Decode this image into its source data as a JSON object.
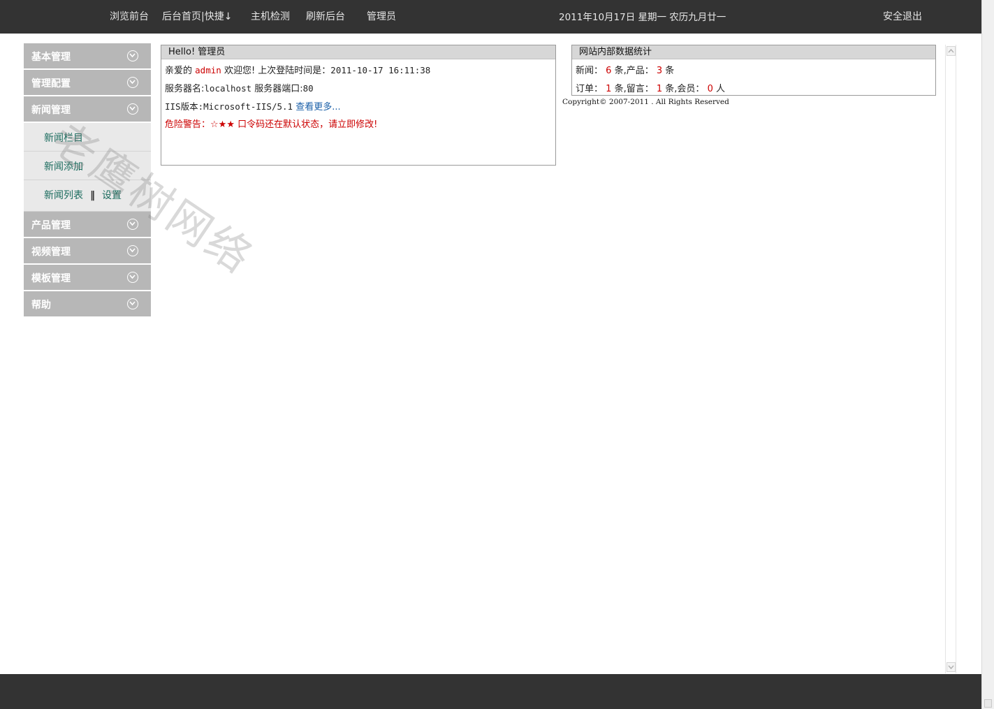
{
  "topbar": {
    "nav": [
      {
        "label": "浏览前台"
      },
      {
        "label": "后台首页|快捷↓"
      },
      {
        "label": "主机检测"
      },
      {
        "label": "刷新后台"
      },
      {
        "label": "管理员"
      }
    ],
    "date": "2011年10月17日  星期一  农历九月廿一",
    "logout": "安全退出"
  },
  "sidebar": {
    "sections": [
      {
        "label": "基本管理"
      },
      {
        "label": "管理配置"
      },
      {
        "label": "新闻管理"
      },
      {
        "label": "产品管理"
      },
      {
        "label": "视频管理"
      },
      {
        "label": "模板管理"
      },
      {
        "label": "帮助"
      }
    ],
    "news_submenu": {
      "category": "新闻栏目",
      "add": "新闻添加",
      "list": "新闻列表",
      "separator": "‖",
      "settings": "设置"
    }
  },
  "welcome": {
    "title": "Hello! 管理员",
    "greet_prefix": "亲爱的",
    "user": "admin",
    "greet_suffix": "欢迎您! 上次登陆时间是：",
    "last_login": "2011-10-17 16:11:38",
    "server_name_label": "服务器名:",
    "server_name": "localhost",
    "server_port_label": "服务器端口:",
    "server_port": "80",
    "iis_label": "IIS版本:",
    "iis_version": "Microsoft-IIS/5.1",
    "more_link": "查看更多...",
    "warning_prefix": "危险警告：",
    "warning_stars": "☆★★",
    "warning_text": "口令码还在默认状态，请立即修改!"
  },
  "stats": {
    "title": "网站内部数据统计",
    "news_label": "新闻：",
    "news_count": "6",
    "product_label": "条,产品：",
    "product_count": "3",
    "unit_tiao": "条",
    "order_label": "订单：",
    "order_count": "1",
    "message_label": "条,留言：",
    "message_count": "1",
    "member_label": "条,会员：",
    "member_count": "0",
    "unit_ren": "人"
  },
  "copyright": "Copyright© 2007-2011 . All Rights Reserved",
  "watermark": "老鹰树网络",
  "colors": {
    "topbar_bg": "#333333",
    "menu_head_bg": "#b7b7b7",
    "submenu_bg": "#e9e9e9",
    "accent_red": "#cc0000",
    "link_blue": "#1a5fa8",
    "submenu_text": "#1a6b5d"
  }
}
